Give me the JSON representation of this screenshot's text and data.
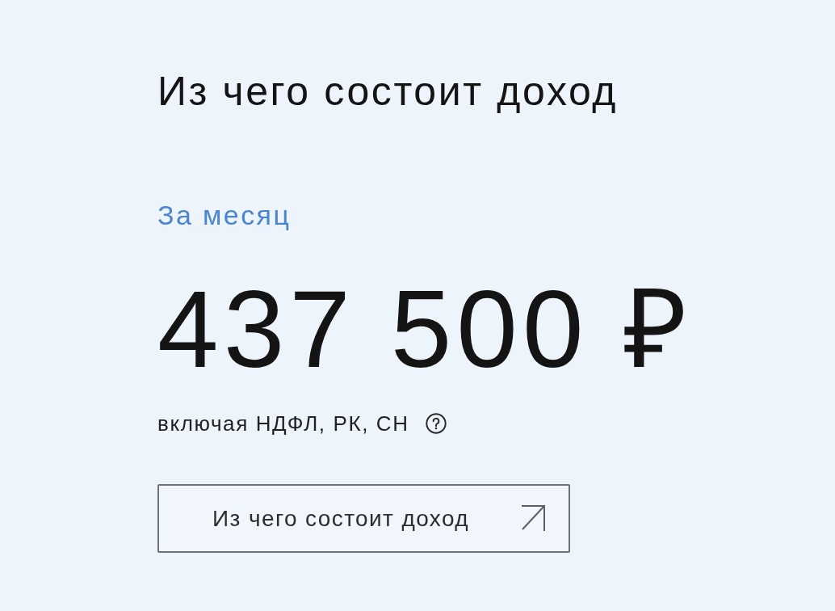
{
  "title": "Из чего состоит доход",
  "period": {
    "label": "За месяц"
  },
  "amount": "437 500 ₽",
  "note": "включая НДФЛ, РК, СН",
  "button": {
    "label": "Из чего состоит доход"
  }
}
